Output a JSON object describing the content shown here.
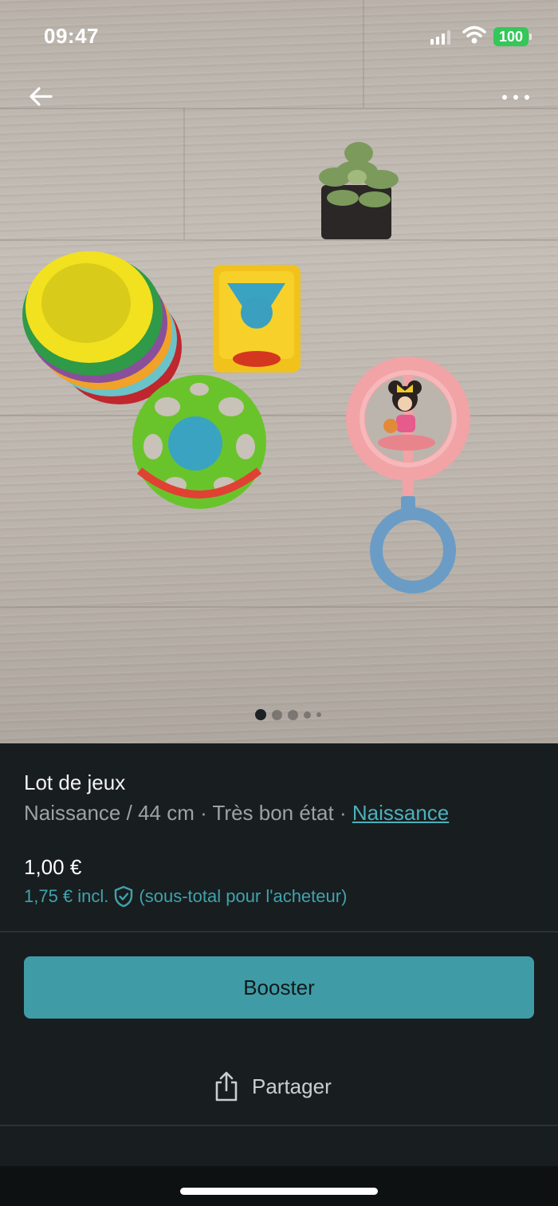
{
  "status": {
    "time": "09:47",
    "battery": "100"
  },
  "photo": {
    "description_icons": [
      "back-arrow-icon",
      "more-dots-icon"
    ],
    "pager": {
      "count": 5,
      "active_index": 0
    }
  },
  "item": {
    "title": "Lot de jeux",
    "meta_prefix": "Naissance / 44 cm · Très bon état · ",
    "category_link": "Naissance",
    "price": "1,00 €",
    "buyer_price": "1,75 € incl.",
    "buyer_note": "(sous-total pour l'acheteur)"
  },
  "actions": {
    "booster_label": "Booster",
    "share_label": "Partager"
  },
  "colors": {
    "accent": "#3f9ca6",
    "link": "#4bb1bb",
    "background": "#181d1f",
    "battery": "#34c759"
  }
}
